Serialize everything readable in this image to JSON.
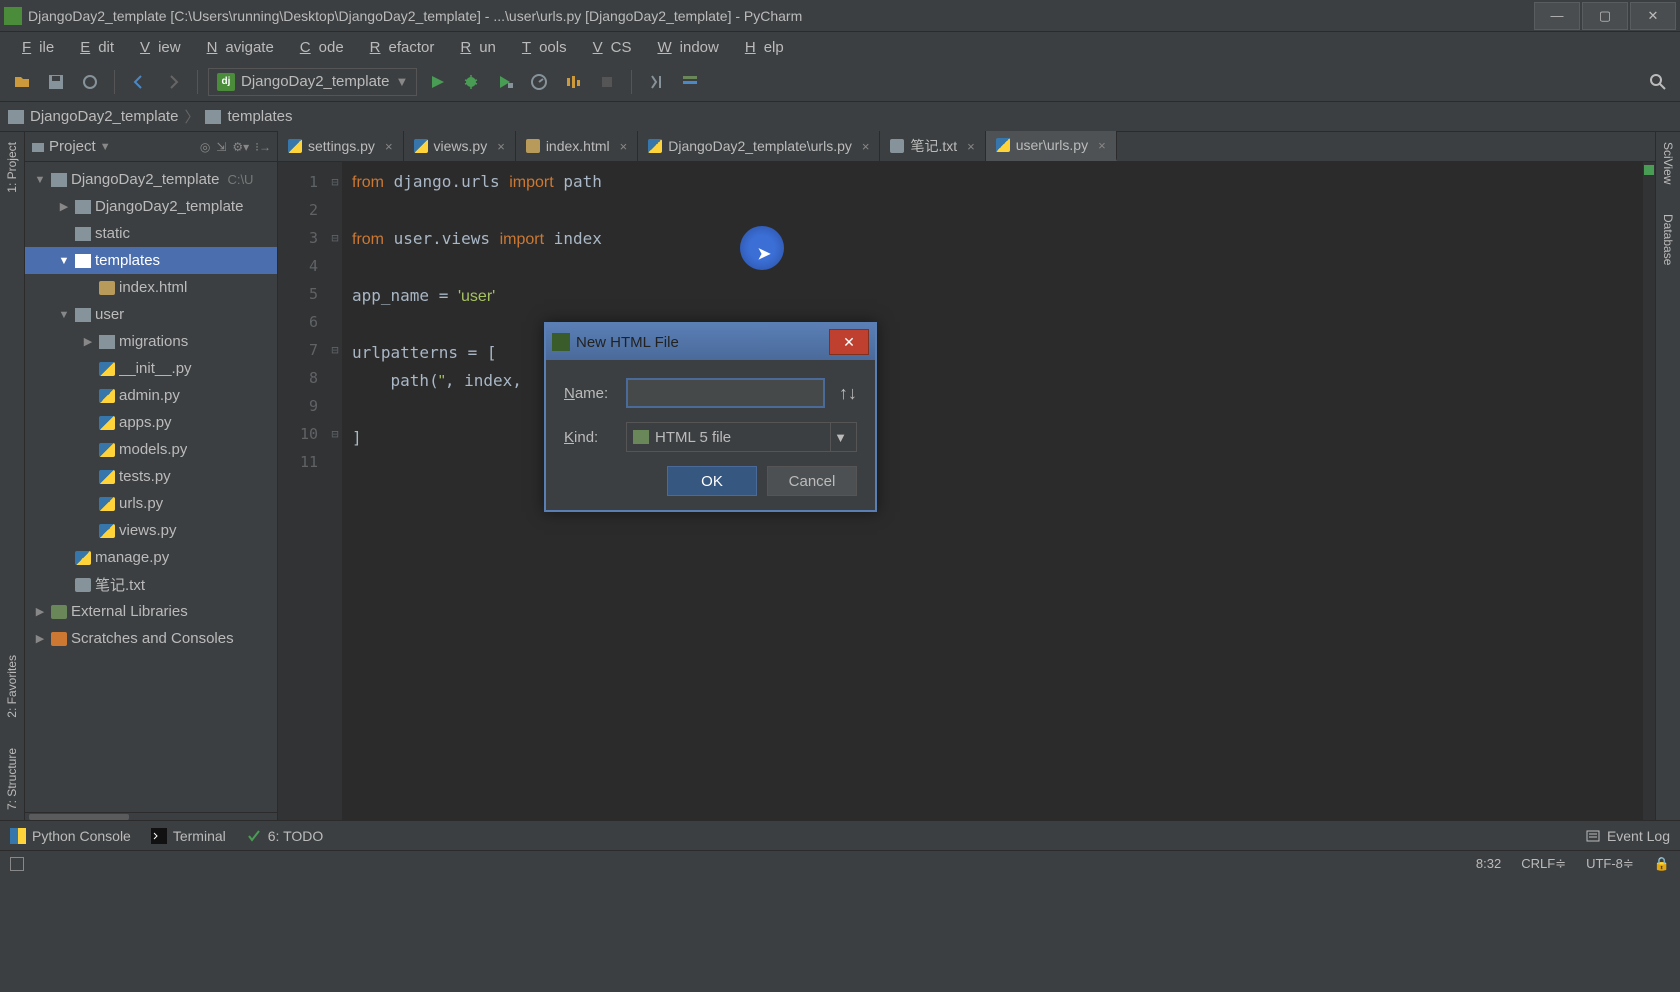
{
  "title_bar": {
    "title": "DjangoDay2_template [C:\\Users\\running\\Desktop\\DjangoDay2_template] - ...\\user\\urls.py [DjangoDay2_template] - PyCharm"
  },
  "menu": [
    "File",
    "Edit",
    "View",
    "Navigate",
    "Code",
    "Refactor",
    "Run",
    "Tools",
    "VCS",
    "Window",
    "Help"
  ],
  "run_config": "DjangoDay2_template",
  "breadcrumb": [
    "DjangoDay2_template",
    "templates"
  ],
  "project_panel": {
    "title": "Project",
    "tree": [
      {
        "depth": 0,
        "arrow": "▼",
        "icon": "folder",
        "label": "DjangoDay2_template",
        "muted": "C:\\U"
      },
      {
        "depth": 1,
        "arrow": "▶",
        "icon": "folder",
        "label": "DjangoDay2_template"
      },
      {
        "depth": 1,
        "arrow": "",
        "icon": "folder",
        "label": "static"
      },
      {
        "depth": 1,
        "arrow": "▼",
        "icon": "folder",
        "label": "templates",
        "selected": true
      },
      {
        "depth": 2,
        "arrow": "",
        "icon": "html",
        "label": "index.html"
      },
      {
        "depth": 1,
        "arrow": "▼",
        "icon": "folder",
        "label": "user"
      },
      {
        "depth": 2,
        "arrow": "▶",
        "icon": "folder",
        "label": "migrations"
      },
      {
        "depth": 2,
        "arrow": "",
        "icon": "py",
        "label": "__init__.py"
      },
      {
        "depth": 2,
        "arrow": "",
        "icon": "py",
        "label": "admin.py"
      },
      {
        "depth": 2,
        "arrow": "",
        "icon": "py",
        "label": "apps.py"
      },
      {
        "depth": 2,
        "arrow": "",
        "icon": "py",
        "label": "models.py"
      },
      {
        "depth": 2,
        "arrow": "",
        "icon": "py",
        "label": "tests.py"
      },
      {
        "depth": 2,
        "arrow": "",
        "icon": "py",
        "label": "urls.py"
      },
      {
        "depth": 2,
        "arrow": "",
        "icon": "py",
        "label": "views.py"
      },
      {
        "depth": 1,
        "arrow": "",
        "icon": "py",
        "label": "manage.py"
      },
      {
        "depth": 1,
        "arrow": "",
        "icon": "txt",
        "label": "笔记.txt"
      },
      {
        "depth": 0,
        "arrow": "▶",
        "icon": "lib",
        "label": "External Libraries"
      },
      {
        "depth": 0,
        "arrow": "▶",
        "icon": "scratch",
        "label": "Scratches and Consoles"
      }
    ]
  },
  "tabs": [
    {
      "icon": "py",
      "label": "settings.py"
    },
    {
      "icon": "py",
      "label": "views.py"
    },
    {
      "icon": "html",
      "label": "index.html"
    },
    {
      "icon": "py",
      "label": "DjangoDay2_template\\urls.py"
    },
    {
      "icon": "txt",
      "label": "笔记.txt"
    },
    {
      "icon": "py",
      "label": "user\\urls.py",
      "active": true
    }
  ],
  "code_lines": [
    {
      "n": 1,
      "fold": "⊟",
      "html": "<span class='kw'>from</span> django.urls <span class='kw'>import</span> path"
    },
    {
      "n": 2,
      "fold": "",
      "html": ""
    },
    {
      "n": 3,
      "fold": "⊟",
      "html": "<span class='kw'>from</span> user.views <span class='kw'>import</span> index"
    },
    {
      "n": 4,
      "fold": "",
      "html": ""
    },
    {
      "n": 5,
      "fold": "",
      "html": "app_name = <span class='str'>'user'</span>"
    },
    {
      "n": 6,
      "fold": "",
      "html": ""
    },
    {
      "n": 7,
      "fold": "⊟",
      "html": "urlpatterns = ["
    },
    {
      "n": 8,
      "fold": "",
      "html": "    path(<span class='str'>''</span>, index,"
    },
    {
      "n": 9,
      "fold": "",
      "html": ""
    },
    {
      "n": 10,
      "fold": "⊟",
      "html": "]"
    },
    {
      "n": 11,
      "fold": "",
      "html": ""
    }
  ],
  "dialog": {
    "title": "New HTML File",
    "name_label": "Name:",
    "name_value": "",
    "kind_label": "Kind:",
    "kind_value": "HTML 5 file",
    "ok": "OK",
    "cancel": "Cancel"
  },
  "left_gutter": [
    "1: Project"
  ],
  "right_gutter": [
    "SciView",
    "Database"
  ],
  "left_gutter_bottom": [
    "2: Favorites",
    "7: Structure"
  ],
  "bottom_tools": {
    "python_console": "Python Console",
    "terminal": "Terminal",
    "todo": "6: TODO",
    "event_log": "Event Log"
  },
  "status": {
    "pos": "8:32",
    "line_sep": "CRLF≑",
    "encoding": "UTF-8≑"
  }
}
